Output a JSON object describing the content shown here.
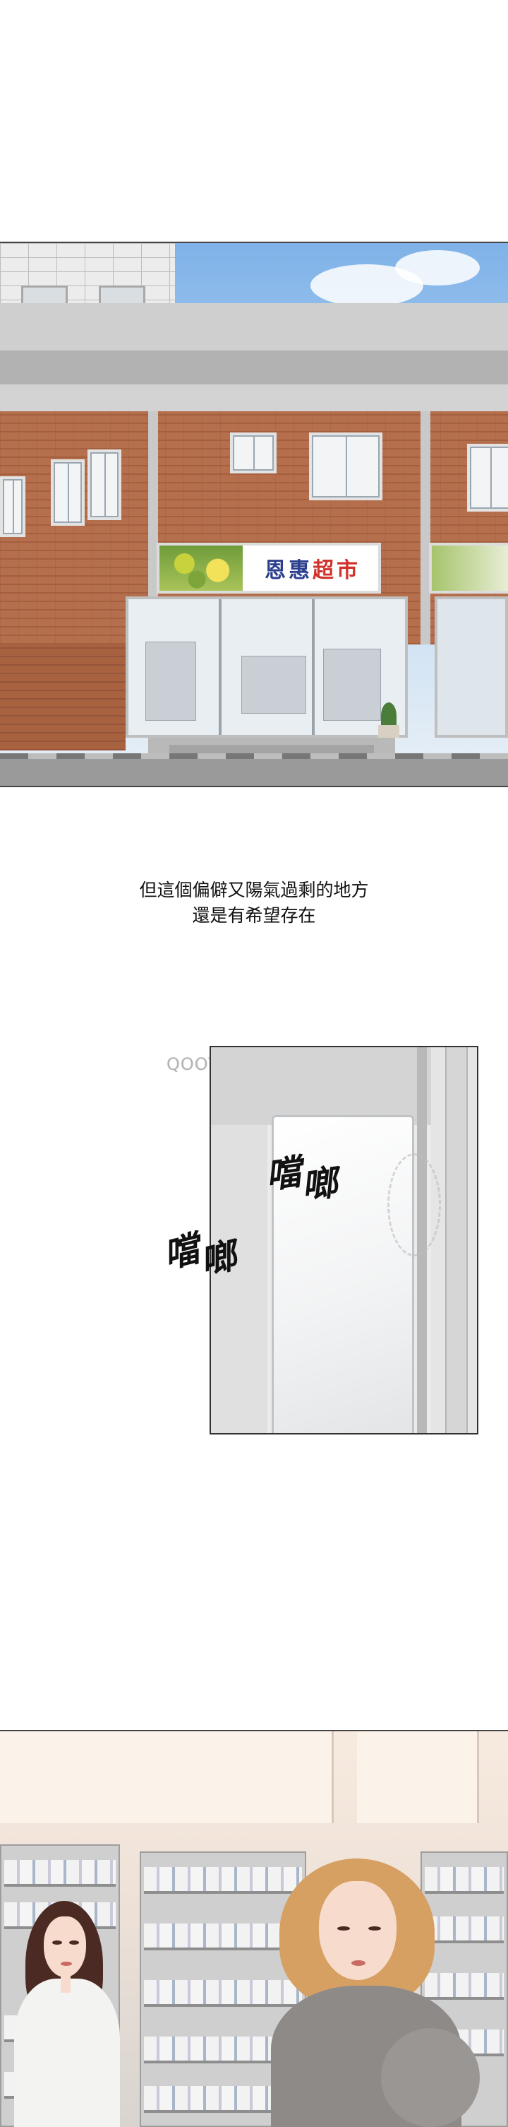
{
  "narration": {
    "line1": "但這個偏僻又陽氣過剩的地方",
    "line2": "還是有希望存在"
  },
  "storefront_sign": {
    "part1": "恩惠",
    "part2": "超市"
  },
  "sound_effects": {
    "sfx1_a": "噹",
    "sfx1_b": "啷",
    "sfx2_a": "噹",
    "sfx2_b": "啷"
  },
  "watermark": "QOOTOON.NET",
  "colors": {
    "sign_blue": "#2b3f8e",
    "sign_red": "#d0332c",
    "sky": "#7fb2e8",
    "brick": "#b56f4c"
  }
}
